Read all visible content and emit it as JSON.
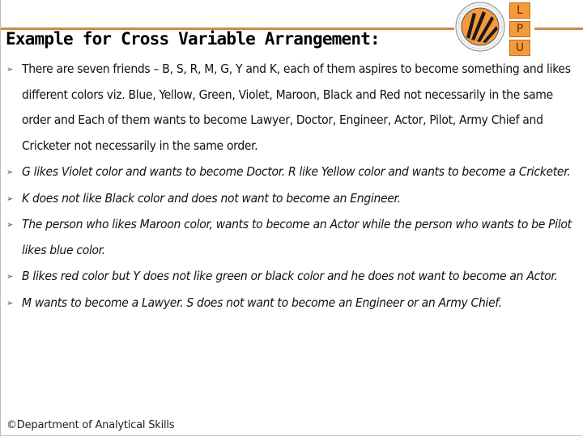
{
  "slide": {
    "title": "Example for Cross Variable Arrangement:",
    "logo": {
      "seal_icon": "lpu-seal-icon",
      "letters": [
        "L",
        "P",
        "U"
      ]
    },
    "bullet_marker": "➢",
    "bullets": [
      {
        "style": "normal",
        "text": "There are seven friends – B, S, R, M, G, Y and K, each of them aspires to become something and likes different colors viz. Blue, Yellow, Green, Violet, Maroon, Black and Red not necessarily in the same order and Each of them wants to become Lawyer, Doctor, Engineer, Actor, Pilot, Army Chief and Cricketer not necessarily in the same order."
      },
      {
        "style": "italic",
        "text": "G likes Violet color and wants to become Doctor. R like Yellow color and wants to become a Cricketer."
      },
      {
        "style": "italic",
        "text": "K does not like Black color and does not want to become an Engineer."
      },
      {
        "style": "italic",
        "text": " The person who likes Maroon color, wants to become an Actor while the person who wants to be Pilot likes blue color."
      },
      {
        "style": "italic",
        "text": "B likes red color but Y does not like green or black color and he does not want to become an Actor."
      },
      {
        "style": "italic",
        "text": "M wants to become a Lawyer. S does not want to become an Engineer or an Army Chief."
      }
    ],
    "footer": "©Department of Analytical Skills",
    "colors": {
      "accent_rule": "#d08a45",
      "logo_orange": "#f39a3b"
    }
  }
}
